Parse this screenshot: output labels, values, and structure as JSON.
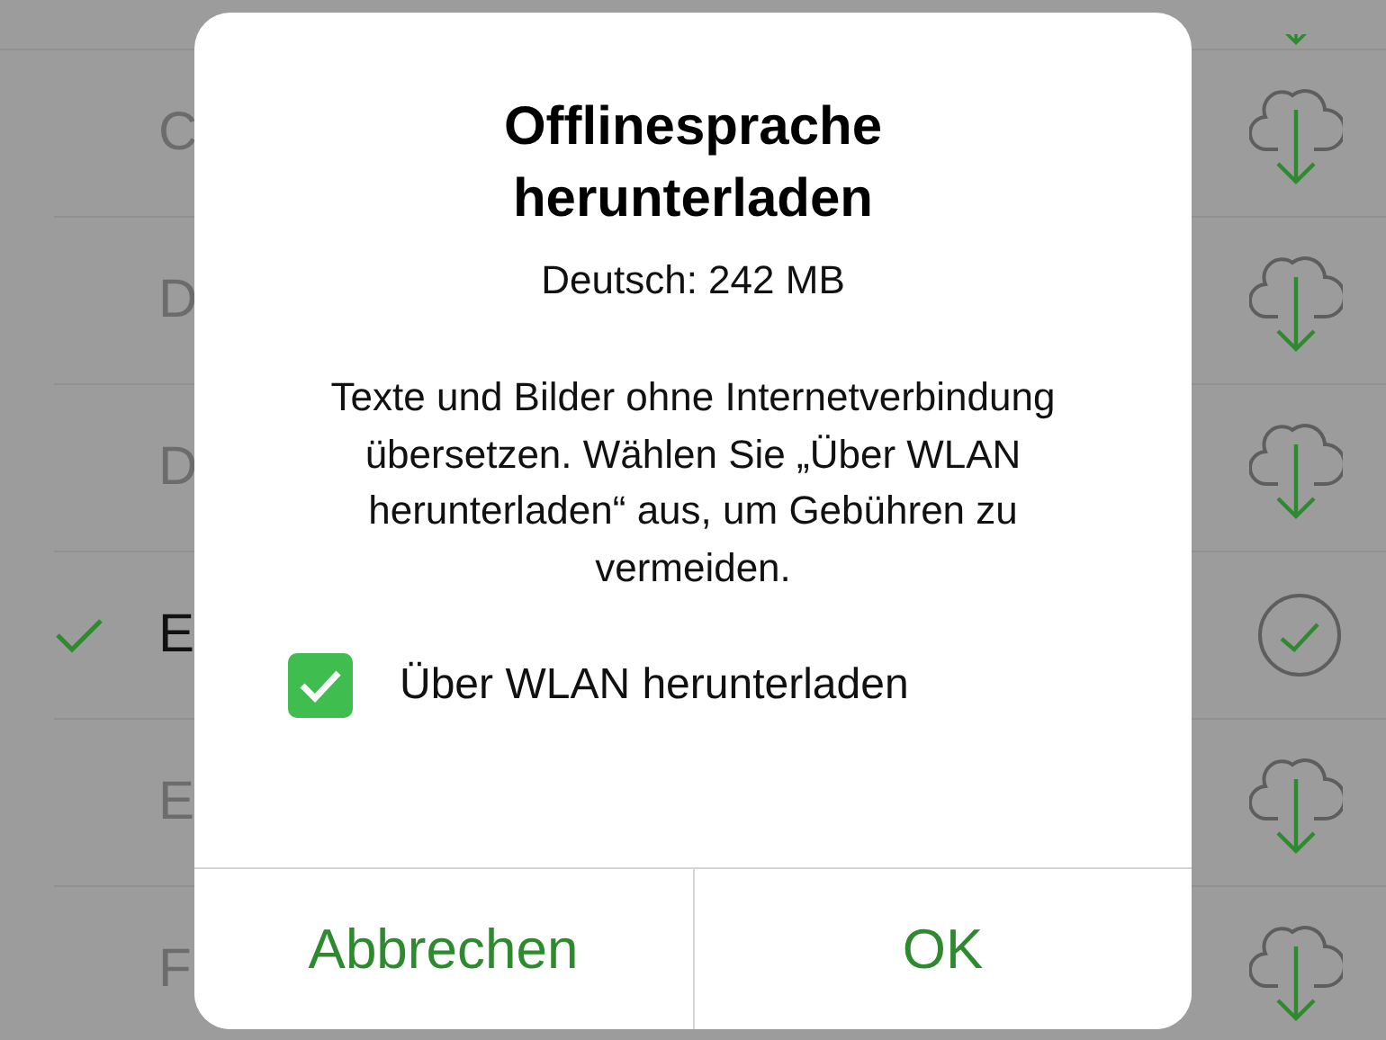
{
  "languages": [
    {
      "name": "C",
      "selected": false,
      "downloaded": false
    },
    {
      "name": "D",
      "selected": false,
      "downloaded": false
    },
    {
      "name": "D",
      "selected": false,
      "downloaded": false
    },
    {
      "name": "E",
      "selected": true,
      "downloaded": true
    },
    {
      "name": "E",
      "selected": false,
      "downloaded": false
    },
    {
      "name": "F",
      "selected": false,
      "downloaded": false
    }
  ],
  "dialog": {
    "title": "Offlinesprache herunterladen",
    "size": "Deutsch: 242 MB",
    "message": "Texte und Bilder ohne Internetverbindung übersetzen. Wählen Sie „Über WLAN herunterladen“ aus, um Gebühren zu vermeiden.",
    "checkbox": {
      "label": "Über WLAN herunterladen",
      "checked": true
    },
    "buttons": [
      "Abbrechen",
      "OK"
    ]
  }
}
